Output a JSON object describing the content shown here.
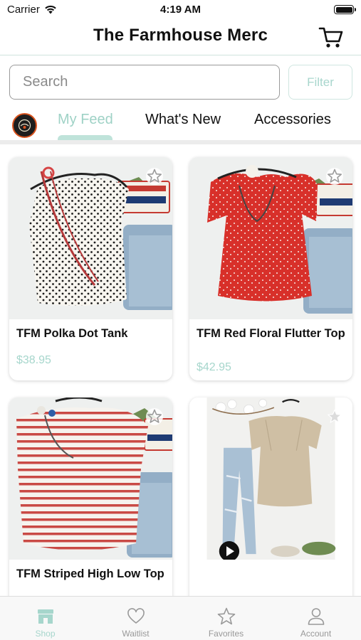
{
  "status_bar": {
    "carrier": "Carrier",
    "time": "4:19 AM"
  },
  "header": {
    "title": "The Farmhouse Merc"
  },
  "search": {
    "placeholder": "Search",
    "filter_label": "Filter"
  },
  "tabs": [
    {
      "label": "My Feed",
      "active": true
    },
    {
      "label": "What's New",
      "active": false
    },
    {
      "label": "Accessories",
      "active": false
    }
  ],
  "products": [
    {
      "name": "TFM Polka Dot Tank",
      "price": "$38.95"
    },
    {
      "name": "TFM Red Floral Flutter Top",
      "price": "$42.95"
    },
    {
      "name": "TFM Striped High Low Top",
      "price": ""
    },
    {
      "name": "",
      "price": ""
    }
  ],
  "tab_bar": [
    {
      "label": "Shop",
      "icon": "shop-icon",
      "active": true
    },
    {
      "label": "Waitlist",
      "icon": "heart-icon",
      "active": false
    },
    {
      "label": "Favorites",
      "icon": "star-icon",
      "active": false
    },
    {
      "label": "Account",
      "icon": "person-icon",
      "active": false
    }
  ],
  "colors": {
    "accent": "#a6d6cc",
    "accent_tab": "#9fd2c6",
    "text": "#111111"
  }
}
